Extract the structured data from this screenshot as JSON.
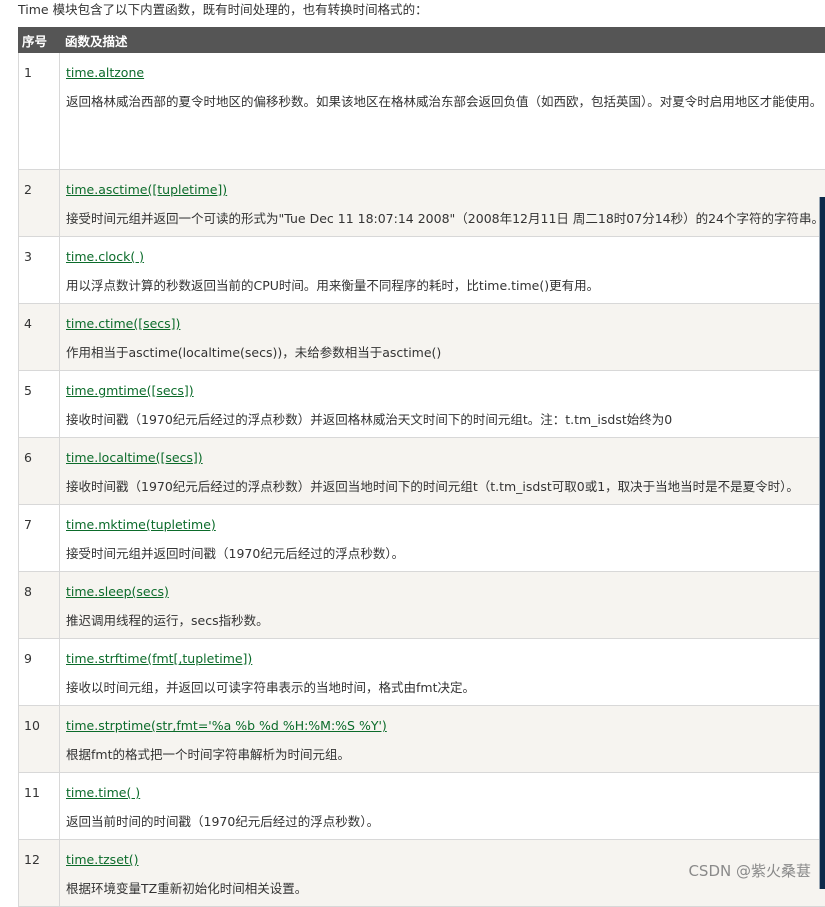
{
  "intro": "Time 模块包含了以下内置函数，既有时间处理的，也有转换时间格式的：",
  "headers": {
    "num": "序号",
    "desc": "函数及描述"
  },
  "rows": [
    {
      "num": "1",
      "fn": "time.altzone",
      "desc": "返回格林威治西部的夏令时地区的偏移秒数。如果该地区在格林威治东部会返回负值（如西欧，包括英国）。对夏令时启用地区才能使用。"
    },
    {
      "num": "2",
      "fn": "time.asctime([tupletime])",
      "desc": "接受时间元组并返回一个可读的形式为\"Tue Dec 11 18:07:14 2008\"（2008年12月11日 周二18时07分14秒）的24个字符的字符串。"
    },
    {
      "num": "3",
      "fn": "time.clock( )",
      "desc": "用以浮点数计算的秒数返回当前的CPU时间。用来衡量不同程序的耗时，比time.time()更有用。"
    },
    {
      "num": "4",
      "fn": "time.ctime([secs])",
      "desc": "作用相当于asctime(localtime(secs))，未给参数相当于asctime()"
    },
    {
      "num": "5",
      "fn": "time.gmtime([secs])",
      "desc": "接收时间戳（1970纪元后经过的浮点秒数）并返回格林威治天文时间下的时间元组t。注：t.tm_isdst始终为0"
    },
    {
      "num": "6",
      "fn": "time.localtime([secs])",
      "desc": "接收时间戳（1970纪元后经过的浮点秒数）并返回当地时间下的时间元组t（t.tm_isdst可取0或1，取决于当地当时是不是夏令时）。"
    },
    {
      "num": "7",
      "fn": "time.mktime(tupletime)",
      "desc": "接受时间元组并返回时间戳（1970纪元后经过的浮点秒数）。"
    },
    {
      "num": "8",
      "fn": "time.sleep(secs)",
      "desc": "推迟调用线程的运行，secs指秒数。"
    },
    {
      "num": "9",
      "fn": "time.strftime(fmt[,tupletime])",
      "desc": "接收以时间元组，并返回以可读字符串表示的当地时间，格式由fmt决定。"
    },
    {
      "num": "10",
      "fn": "time.strptime(str,fmt='%a %b %d %H:%M:%S %Y')",
      "desc": "根据fmt的格式把一个时间字符串解析为时间元组。"
    },
    {
      "num": "11",
      "fn": "time.time( )",
      "desc": "返回当前时间的时间戳（1970纪元后经过的浮点秒数）。"
    },
    {
      "num": "12",
      "fn": "time.tzset()",
      "desc": "根据环境变量TZ重新初始化时间相关设置。"
    }
  ],
  "watermark": "CSDN @紫火桑葚"
}
